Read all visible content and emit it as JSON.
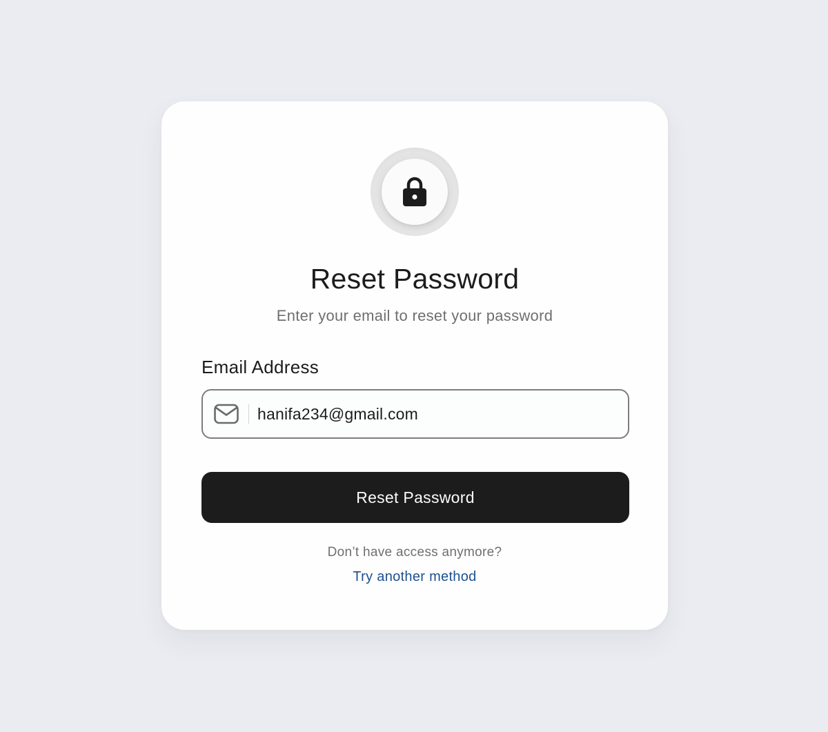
{
  "icons": {
    "header": "lock-icon",
    "email_field": "mail-icon"
  },
  "colors": {
    "background": "#ebecf1",
    "card": "#fdfefd",
    "primary_button": "#1d1c1d",
    "link": "#1d4f8f",
    "muted_text": "#6f6f70"
  },
  "header": {
    "title": "Reset Password",
    "subtitle": "Enter your email to reset your password"
  },
  "form": {
    "email_label": "Email Address",
    "email_value": "hanifa234@gmail.com",
    "submit_label": "Reset Password"
  },
  "footer": {
    "prompt": "Don’t have access anymore?",
    "link_label": "Try another method"
  }
}
